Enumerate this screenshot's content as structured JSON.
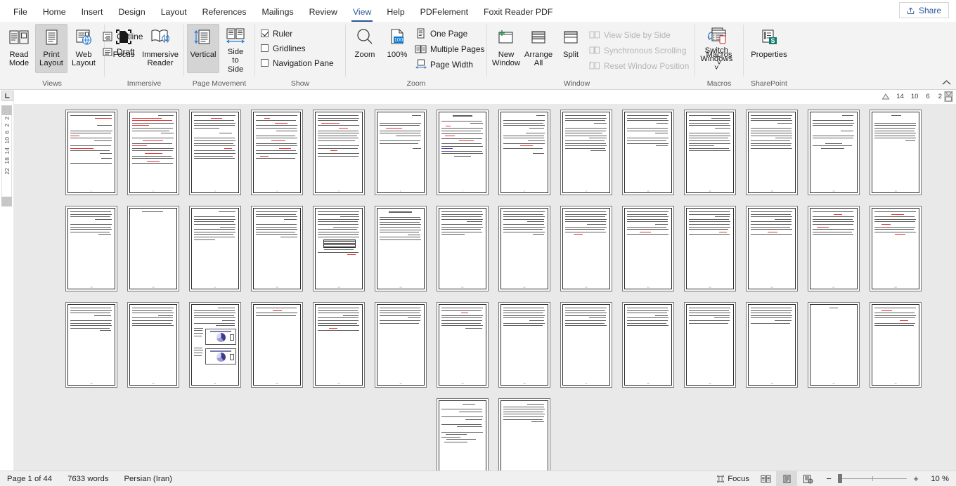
{
  "tabs": [
    {
      "label": "File",
      "active": false
    },
    {
      "label": "Home",
      "active": false
    },
    {
      "label": "Insert",
      "active": false
    },
    {
      "label": "Design",
      "active": false
    },
    {
      "label": "Layout",
      "active": false
    },
    {
      "label": "References",
      "active": false
    },
    {
      "label": "Mailings",
      "active": false
    },
    {
      "label": "Review",
      "active": false
    },
    {
      "label": "View",
      "active": true
    },
    {
      "label": "Help",
      "active": false
    },
    {
      "label": "PDFelement",
      "active": false
    },
    {
      "label": "Foxit Reader PDF",
      "active": false
    }
  ],
  "share": {
    "label": "Share",
    "icon": "share-icon"
  },
  "ribbon": {
    "groups": [
      {
        "name": "views",
        "label": "Views",
        "big_buttons": [
          {
            "label": "Read\nMode",
            "label_line1": "Read",
            "label_line2": "Mode",
            "icon": "read-mode-icon",
            "selected": false
          },
          {
            "label": "Print Layout",
            "label_line1": "Print",
            "label_line2": "Layout",
            "icon": "print-layout-icon",
            "selected": true
          },
          {
            "label": "Web Layout",
            "label_line1": "Web",
            "label_line2": "Layout",
            "icon": "web-layout-icon",
            "selected": false
          }
        ],
        "small_items": [
          {
            "label": "Outline",
            "icon": "outline-icon"
          },
          {
            "label": "Draft",
            "icon": "draft-icon"
          }
        ]
      },
      {
        "name": "immersive",
        "label": "Immersive",
        "big_buttons": [
          {
            "label_line1": "Focus",
            "label_line2": "",
            "icon": "focus-icon",
            "selected": false
          },
          {
            "label_line1": "Immersive",
            "label_line2": "Reader",
            "icon": "immersive-reader-icon",
            "selected": false
          }
        ]
      },
      {
        "name": "page-movement",
        "label": "Page Movement",
        "big_buttons": [
          {
            "label_line1": "Vertical",
            "label_line2": "",
            "icon": "vertical-scroll-icon",
            "selected": true
          },
          {
            "label_line1": "Side",
            "label_line2": "to Side",
            "icon": "side-to-side-icon",
            "selected": false
          }
        ]
      },
      {
        "name": "show",
        "label": "Show",
        "checkboxes": [
          {
            "label": "Ruler",
            "checked": true
          },
          {
            "label": "Gridlines",
            "checked": false
          },
          {
            "label": "Navigation Pane",
            "checked": false
          }
        ]
      },
      {
        "name": "zoom",
        "label": "Zoom",
        "big_buttons": [
          {
            "label_line1": "Zoom",
            "label_line2": "",
            "icon": "zoom-magnifier-icon",
            "selected": false
          },
          {
            "label_line1": "100%",
            "label_line2": "",
            "icon": "zoom-100-icon",
            "selected": false
          }
        ],
        "small_items": [
          {
            "label": "One Page",
            "icon": "one-page-icon"
          },
          {
            "label": "Multiple Pages",
            "icon": "multiple-pages-icon"
          },
          {
            "label": "Page Width",
            "icon": "page-width-icon"
          }
        ]
      },
      {
        "name": "window",
        "label": "Window",
        "big_buttons": [
          {
            "label_line1": "New",
            "label_line2": "Window",
            "icon": "new-window-icon",
            "selected": false
          },
          {
            "label_line1": "Arrange",
            "label_line2": "All",
            "icon": "arrange-all-icon",
            "selected": false
          },
          {
            "label_line1": "Split",
            "label_line2": "",
            "icon": "split-icon",
            "selected": false
          }
        ],
        "small_items": [
          {
            "label": "View Side by Side",
            "icon": "view-side-by-side-icon",
            "disabled": true
          },
          {
            "label": "Synchronous Scrolling",
            "icon": "synchronous-scrolling-icon",
            "disabled": true
          },
          {
            "label": "Reset Window Position",
            "icon": "reset-window-position-icon",
            "disabled": true
          }
        ]
      },
      {
        "name": "window-switch",
        "label": "",
        "big_buttons": [
          {
            "label_line1": "Switch",
            "label_line2": "Windows ˅",
            "icon": "switch-windows-icon",
            "selected": false
          }
        ]
      },
      {
        "name": "macros",
        "label": "Macros",
        "big_buttons": [
          {
            "label_line1": "Macros",
            "label_line2": "˅",
            "icon": "macros-icon",
            "selected": false
          }
        ]
      },
      {
        "name": "sharepoint",
        "label": "SharePoint",
        "big_buttons": [
          {
            "label_line1": "Properties",
            "label_line2": "",
            "icon": "properties-icon",
            "selected": false
          }
        ]
      }
    ],
    "collapse_icon": "chevron-up-icon"
  },
  "rulers": {
    "horizontal_marks": [
      "14",
      "10",
      "6",
      "2"
    ],
    "vertical_marks": [
      "2",
      "2",
      "6",
      "10",
      "14",
      "18",
      "22"
    ],
    "corner_icon": "tab-stop-icon"
  },
  "document": {
    "zoom_percent": "10 %",
    "rows": [
      {
        "count": 14
      },
      {
        "count": 14
      },
      {
        "count": 14
      },
      {
        "count": 2
      }
    ],
    "total_pages": 44
  },
  "status": {
    "page_info": "Page 1 of 44",
    "word_count": "7633 words",
    "language": "Persian (Iran)",
    "focus_label": "Focus",
    "focus_icon": "focus-mode-icon",
    "view_buttons": [
      {
        "name": "read-mode-view",
        "icon": "read-mode-view-icon",
        "active": false
      },
      {
        "name": "print-layout-view",
        "icon": "print-layout-view-icon",
        "active": true
      },
      {
        "name": "web-layout-view",
        "icon": "web-layout-view-icon",
        "active": false
      }
    ],
    "zoom_out_label": "−",
    "zoom_in_label": "+",
    "zoom_label": "10 %"
  }
}
